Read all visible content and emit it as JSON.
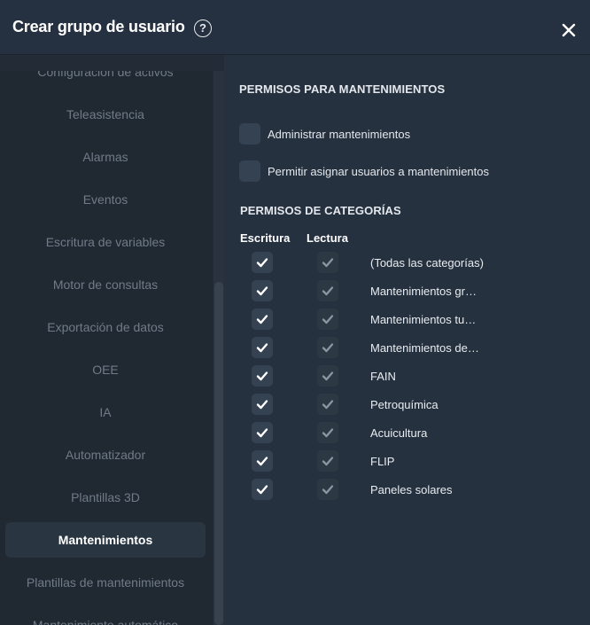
{
  "dialog": {
    "title": "Crear grupo de usuario",
    "help": "?"
  },
  "sidebar": {
    "items": [
      {
        "label": "Configuración de activos"
      },
      {
        "label": "Teleasistencia"
      },
      {
        "label": "Alarmas"
      },
      {
        "label": "Eventos"
      },
      {
        "label": "Escritura de variables"
      },
      {
        "label": "Motor de consultas"
      },
      {
        "label": "Exportación de datos"
      },
      {
        "label": "OEE"
      },
      {
        "label": "IA"
      },
      {
        "label": "Automatizador"
      },
      {
        "label": "Plantillas 3D"
      },
      {
        "label": "Mantenimientos",
        "active": true
      },
      {
        "label": "Plantillas de mantenimientos"
      },
      {
        "label": "Mantenimiento automático"
      }
    ]
  },
  "maintenance_permissions": {
    "heading": "PERMISOS PARA MANTENIMIENTOS",
    "options": [
      {
        "label": "Administrar mantenimientos",
        "checked": false
      },
      {
        "label": "Permitir asignar usuarios a mantenimientos",
        "checked": false
      }
    ]
  },
  "category_permissions": {
    "heading": "PERMISOS DE CATEGORÍAS",
    "write_header": "Escritura",
    "read_header": "Lectura",
    "rows": [
      {
        "name": "(Todas las categorías)",
        "write": true,
        "read": true
      },
      {
        "name": "Mantenimientos gr…",
        "write": true,
        "read": true
      },
      {
        "name": "Mantenimientos tu…",
        "write": true,
        "read": true
      },
      {
        "name": "Mantenimientos de…",
        "write": true,
        "read": true
      },
      {
        "name": "FAIN",
        "write": true,
        "read": true
      },
      {
        "name": "Petroquímica",
        "write": true,
        "read": true
      },
      {
        "name": "Acuicultura",
        "write": true,
        "read": true
      },
      {
        "name": "FLIP",
        "write": true,
        "read": true
      },
      {
        "name": "Paneles solares",
        "write": true,
        "read": true
      }
    ]
  },
  "colors": {
    "write_check": "#ffffff",
    "read_check": "#8a949e"
  }
}
